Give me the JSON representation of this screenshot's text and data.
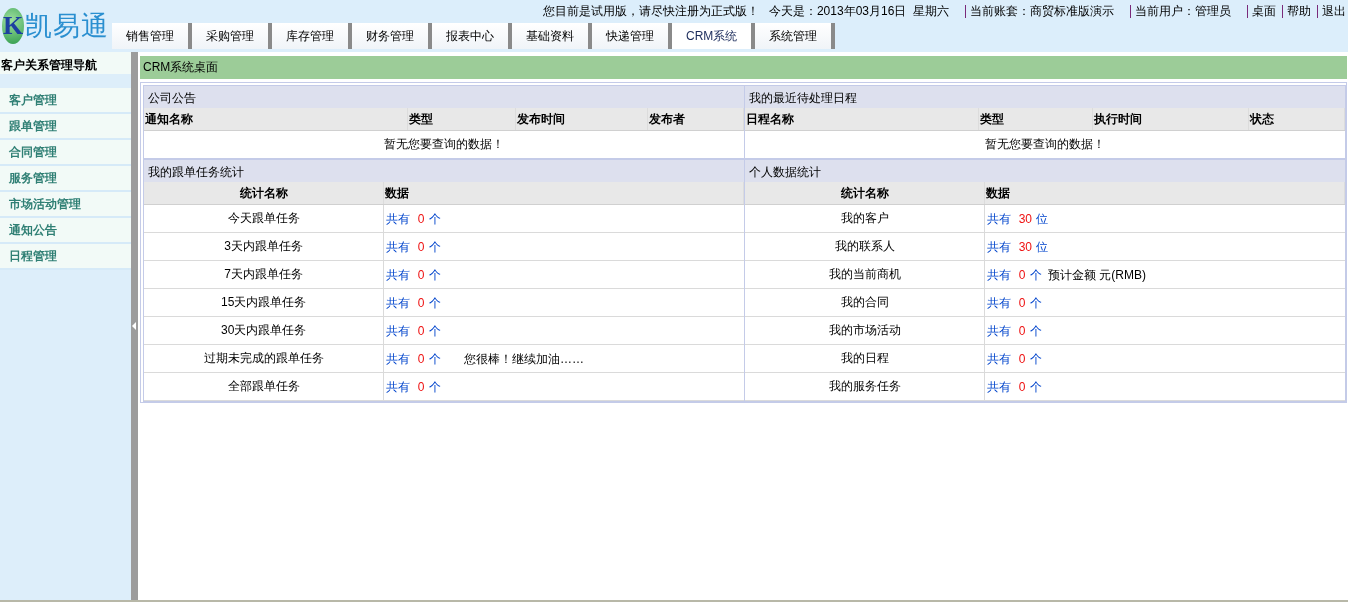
{
  "header": {
    "logo_mark": "K",
    "logo_name": "凯易通",
    "notice": "您目前是试用版，请尽快注册为正式版！",
    "date": "今天是：2013年03月16日  星期六",
    "links": [
      {
        "label": "当前账套：商贸标准版演示",
        "kind": "info"
      },
      {
        "label": "当前用户：管理员",
        "kind": "info"
      },
      {
        "label": "桌面",
        "kind": "link"
      },
      {
        "label": "帮助",
        "kind": "link"
      },
      {
        "label": "退出",
        "kind": "link"
      }
    ]
  },
  "tabs": [
    {
      "label": "销售管理",
      "selected": false
    },
    {
      "label": "采购管理",
      "selected": false
    },
    {
      "label": "库存管理",
      "selected": false
    },
    {
      "label": "财务管理",
      "selected": false
    },
    {
      "label": "报表中心",
      "selected": false
    },
    {
      "label": "基础资料",
      "selected": false
    },
    {
      "label": "快递管理",
      "selected": false
    },
    {
      "label": "CRM系统",
      "selected": true
    },
    {
      "label": "系统管理",
      "selected": false
    }
  ],
  "sidebar": {
    "title": "客户关系管理导航",
    "items": [
      "客户管理",
      "跟单管理",
      "合同管理",
      "服务管理",
      "市场活动管理",
      "通知公告",
      "日程管理"
    ]
  },
  "page_title": "CRM系统桌面",
  "lists": [
    {
      "title": "公司公告",
      "columns": [
        "通知名称",
        "类型",
        "发布时间",
        "发布者"
      ],
      "empty": "暂无您要查询的数据！"
    },
    {
      "title": "我的最近待处理日程",
      "columns": [
        "日程名称",
        "类型",
        "执行时间",
        "状态"
      ],
      "empty": "暂无您要查询的数据！"
    }
  ],
  "stats": [
    {
      "title": "我的跟单任务统计",
      "columns": [
        "统计名称",
        "数据"
      ],
      "rows": [
        {
          "name": "今天跟单任务",
          "prefix": "共有",
          "count": "0",
          "unit": "个"
        },
        {
          "name": "3天内跟单任务",
          "prefix": "共有",
          "count": "0",
          "unit": "个"
        },
        {
          "name": "7天内跟单任务",
          "prefix": "共有",
          "count": "0",
          "unit": "个"
        },
        {
          "name": "15天内跟单任务",
          "prefix": "共有",
          "count": "0",
          "unit": "个"
        },
        {
          "name": "30天内跟单任务",
          "prefix": "共有",
          "count": "0",
          "unit": "个"
        },
        {
          "name": "过期未完成的跟单任务",
          "prefix": "共有",
          "count": "0",
          "unit": "个",
          "note": "您很棒！继续加油……"
        },
        {
          "name": "全部跟单任务",
          "prefix": "共有",
          "count": "0",
          "unit": "个"
        }
      ]
    },
    {
      "title": "个人数据统计",
      "columns": [
        "统计名称",
        "数据"
      ],
      "rows": [
        {
          "name": "我的客户",
          "prefix": "共有",
          "count": "30",
          "unit": "位"
        },
        {
          "name": "我的联系人",
          "prefix": "共有",
          "count": "30",
          "unit": "位"
        },
        {
          "name": "我的当前商机",
          "prefix": "共有",
          "count": "0",
          "unit": "个",
          "note": "预计金额 元(RMB)"
        },
        {
          "name": "我的合同",
          "prefix": "共有",
          "count": "0",
          "unit": "个"
        },
        {
          "name": "我的市场活动",
          "prefix": "共有",
          "count": "0",
          "unit": "个"
        },
        {
          "name": "我的日程",
          "prefix": "共有",
          "count": "0",
          "unit": "个"
        },
        {
          "name": "我的服务任务",
          "prefix": "共有",
          "count": "0",
          "unit": "个"
        }
      ]
    }
  ]
}
